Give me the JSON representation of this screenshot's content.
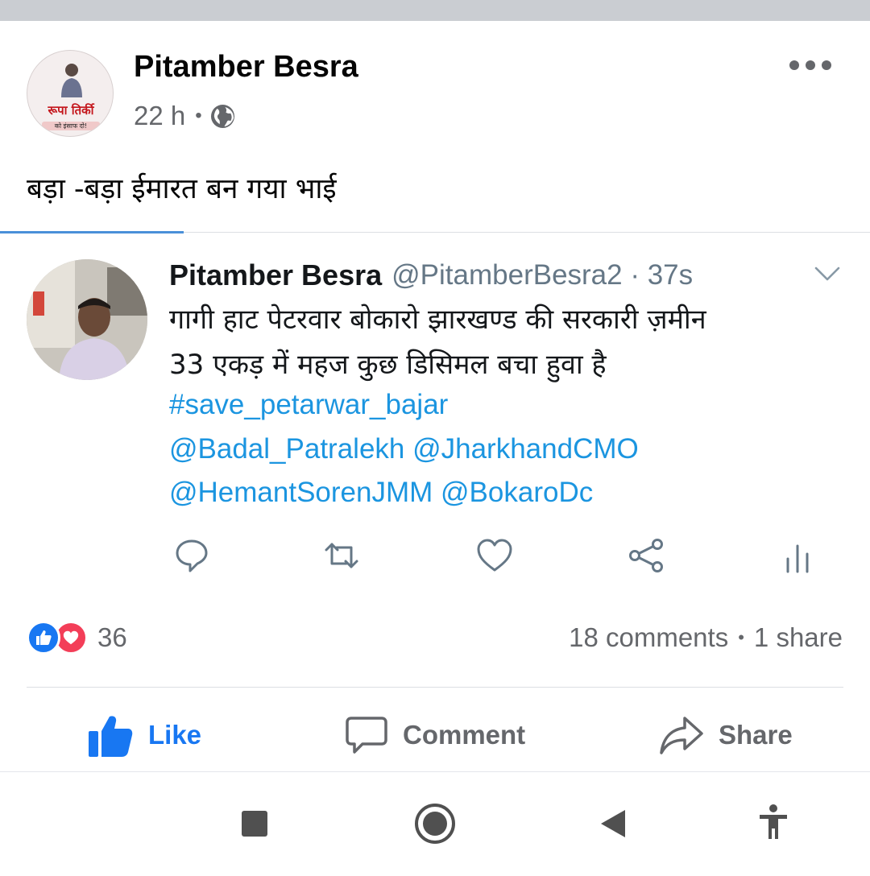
{
  "post": {
    "author": "Pitamber Besra",
    "time": "22 h",
    "separator": "•",
    "text": "बड़ा -बड़ा ईमारत बन गया भाई",
    "avatar_logo_text": "रूपा तिर्की",
    "avatar_logo_sub": "को इंसाफ दो!"
  },
  "tweet": {
    "name": "Pitamber Besra",
    "handle": "@PitamberBesra2 · 37s",
    "lines": [
      "गागी हाट पेटरवार बोकारो झारखण्ड की सरकारी ज़मीन",
      "33 एकड़ में महज कुछ डिसिमल बचा हुवा है"
    ],
    "hashtag": "#save_petarwar_bajar",
    "mentions_1": "@Badal_Patralekh @JharkhandCMO",
    "mentions_2": "@HemantSorenJMM @BokaroDc",
    "actions": [
      "reply-icon",
      "retweet-icon",
      "heart-icon",
      "share-icon",
      "analytics-icon"
    ]
  },
  "engagement": {
    "reaction_count": "36",
    "comments": "18 comments",
    "separator": "•",
    "shares": "1 share"
  },
  "actions": {
    "like": "Like",
    "comment": "Comment",
    "share": "Share"
  },
  "colors": {
    "facebook_blue": "#1877f2",
    "twitter_link": "#1b95e0",
    "love_red": "#f33e58",
    "meta_gray": "#65676b"
  },
  "navbar": [
    "recents-square-icon",
    "home-circle-icon",
    "back-triangle-icon",
    "accessibility-icon"
  ]
}
